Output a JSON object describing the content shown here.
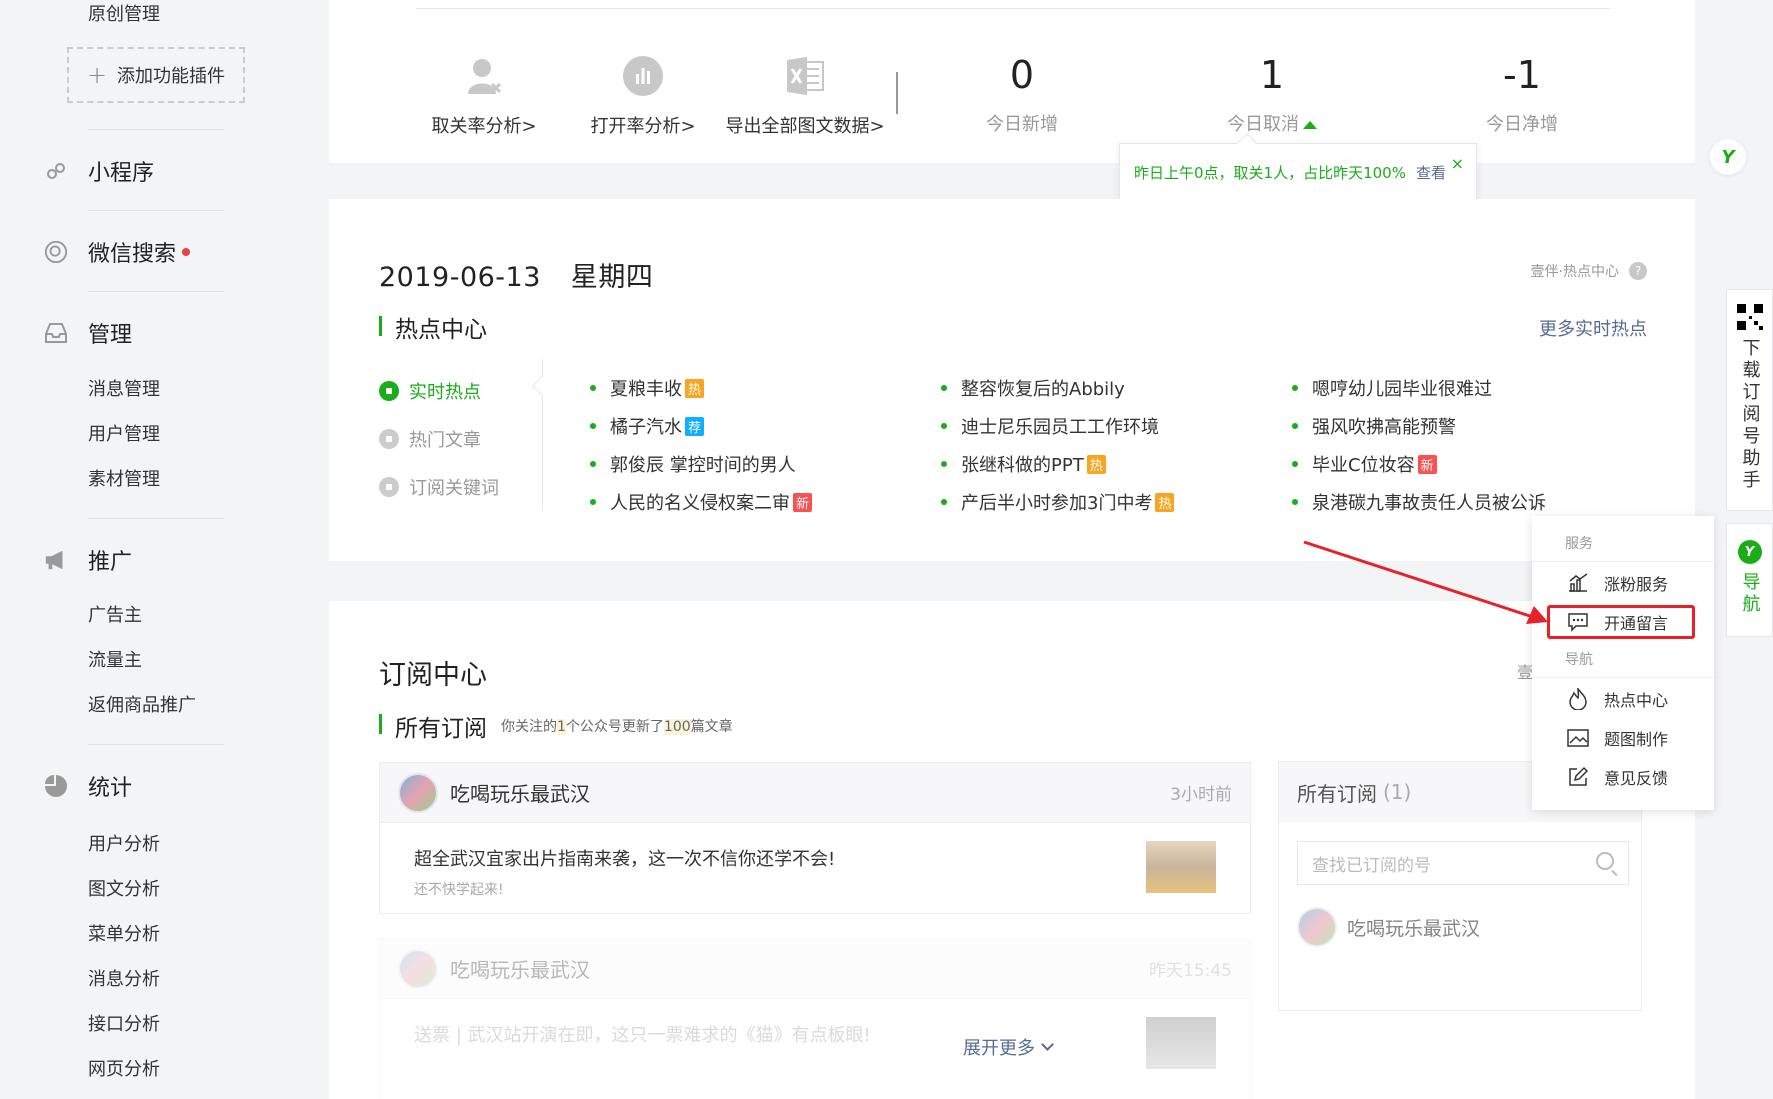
{
  "sidebar": {
    "top_item": "原创管理",
    "add_plugin": "添加功能插件",
    "groups": {
      "miniprogram": "小程序",
      "wechat_search": "微信搜索",
      "manage": "管理",
      "promote": "推广",
      "stats": "统计"
    },
    "manage_items": [
      "消息管理",
      "用户管理",
      "素材管理"
    ],
    "promote_items": [
      "广告主",
      "流量主",
      "返佣商品推广"
    ],
    "stats_items": [
      "用户分析",
      "图文分析",
      "菜单分析",
      "消息分析",
      "接口分析",
      "网页分析"
    ]
  },
  "stats": {
    "tools": [
      {
        "label": "取关率分析>",
        "icon": "user-unfollow-icon"
      },
      {
        "label": "打开率分析>",
        "icon": "chart-circle-icon"
      },
      {
        "label": "导出全部图文数据>",
        "icon": "excel-icon"
      }
    ],
    "numbers": [
      {
        "value": "0",
        "label": "今日新增"
      },
      {
        "value": "1",
        "label": "今日取消"
      },
      {
        "value": "-1",
        "label": "今日净增"
      }
    ],
    "tooltip": {
      "text": "昨日上午0点，取关1人，占比昨天100%",
      "link": "查看",
      "close": "×"
    }
  },
  "hot": {
    "date": "2019-06-13",
    "weekday": "星期四",
    "brand": "壹伴·热点中心",
    "title": "热点中心",
    "more": "更多实时热点",
    "nav": [
      "实时热点",
      "热门文章",
      "订阅关键词"
    ],
    "columns": [
      [
        {
          "text": "夏粮丰收",
          "tag": "热",
          "tag_type": "hot"
        },
        {
          "text": "橘子汽水",
          "tag": "荐",
          "tag_type": "rec"
        },
        {
          "text": "郭俊辰 掌控时间的男人",
          "tag": "",
          "tag_type": ""
        },
        {
          "text": "人民的名义侵权案二审",
          "tag": "新",
          "tag_type": "new"
        }
      ],
      [
        {
          "text": "整容恢复后的Abbily",
          "tag": "",
          "tag_type": ""
        },
        {
          "text": "迪士尼乐园员工工作环境",
          "tag": "",
          "tag_type": ""
        },
        {
          "text": "张继科做的PPT",
          "tag": "热",
          "tag_type": "hot"
        },
        {
          "text": "产后半小时参加3门中考",
          "tag": "热",
          "tag_type": "hot"
        }
      ],
      [
        {
          "text": "嗯哼幼儿园毕业很难过",
          "tag": "",
          "tag_type": ""
        },
        {
          "text": "强风吹拂高能预警",
          "tag": "",
          "tag_type": ""
        },
        {
          "text": "毕业C位妆容",
          "tag": "新",
          "tag_type": "new"
        },
        {
          "text": "泉港碳九事故责任人员被公诉",
          "tag": "",
          "tag_type": ""
        }
      ]
    ]
  },
  "sub": {
    "title": "订阅中心",
    "brand_cut": "壹",
    "subtitle": "所有订阅",
    "note_pre": "你关注的",
    "note_n1": "1",
    "note_mid": "个公众号更新了",
    "note_n2": "100",
    "note_post": "篇文章",
    "feeds": [
      {
        "name": "吃喝玩乐最武汉",
        "time": "3小时前",
        "title": "超全武汉宜家出片指南来袭，这一次不信你还学不会!",
        "sub": "还不快学起来!"
      },
      {
        "name": "吃喝玩乐最武汉",
        "time": "昨天15:45",
        "title": "送票 | 武汉站开演在即，这只一票难求的《猫》有点板眼!",
        "sub": ""
      }
    ],
    "expand": "展开更多",
    "side_title": "所有订阅",
    "side_count": "(1)",
    "search_placeholder": "查找已订阅的号",
    "side_item": "吃喝玩乐最武汉"
  },
  "float": {
    "download": "下载订阅号助手",
    "nav": "导航"
  },
  "menu": {
    "group_service": "服务",
    "group_nav": "导航",
    "items_service": [
      "涨粉服务",
      "开通留言"
    ],
    "items_nav": [
      "热点中心",
      "题图制作",
      "意见反馈"
    ]
  },
  "colors": {
    "accent": "#1aad19",
    "link": "#576b95",
    "annotation": "#e8202a"
  }
}
